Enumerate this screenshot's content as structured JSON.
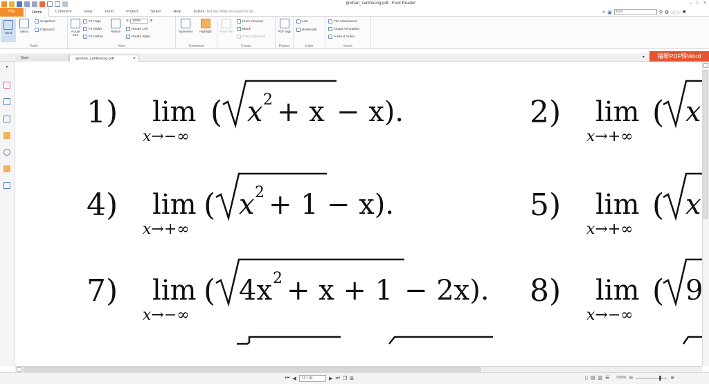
{
  "window": {
    "title": "gioihan_canthuong.pdf - Foxit Reader"
  },
  "menu": {
    "file_label": "File",
    "tabs": [
      "Home",
      "Comment",
      "View",
      "Form",
      "Protect",
      "Share",
      "Help",
      "Extras"
    ],
    "tell_me": "Tell me what you want to do...",
    "find_placeholder": "Find"
  },
  "ribbon": {
    "tools": {
      "label": "Tools",
      "hand": "Hand",
      "select": "Select",
      "snapshot": "SnapShot",
      "clipboard": "Clipboard"
    },
    "view": {
      "label": "View",
      "actual_size": "Actual Size",
      "fit_page": "Fit Page",
      "fit_width": "Fit Width",
      "fit_visible": "Fit Visible",
      "reflow": "Reflow",
      "zoom": "100%",
      "rotate_left": "Rotate Left",
      "rotate_right": "Rotate Right"
    },
    "comment": {
      "label": "Comment",
      "typewriter": "Typewriter",
      "highlight": "Highlight"
    },
    "create": {
      "label": "Create",
      "from_file": "From File",
      "from_scanner": "From Scanner",
      "blank": "Blank",
      "from_clipboard": "From Clipboard"
    },
    "protect": {
      "label": "Protect",
      "pdf_sign": "PDF Sign"
    },
    "links": {
      "label": "Links",
      "link": "Link",
      "bookmark": "Bookmark"
    },
    "insert": {
      "label": "Insert",
      "file_attachment": "File Attachment",
      "image_annotation": "Image Annotation",
      "audio_video": "Audio & Video"
    }
  },
  "doc_tabs": {
    "start": "Start",
    "file": "gioihan_canthuong.pdf"
  },
  "promo": "福昕PDF转Word",
  "document": {
    "problems": [
      {
        "num": "1)",
        "sub": "x→−∞",
        "expr_a": "x",
        "expr_b": " + x",
        "tail": " − x)."
      },
      {
        "num": "2)",
        "sub": "x→+∞"
      },
      {
        "num": "4)",
        "sub": "x→+∞",
        "expr_a": "x",
        "expr_b": " + 1",
        "tail": " − x)."
      },
      {
        "num": "5)",
        "sub": "x→+∞"
      },
      {
        "num": "7)",
        "sub": "x→−∞",
        "expr_a": "4x",
        "expr_b": " + x + 1",
        "tail": " − 2x)."
      },
      {
        "num": "8)",
        "sub": "x→−∞"
      }
    ],
    "lim": "lim"
  },
  "status": {
    "page": "11 / 41",
    "zoom": "500%"
  }
}
